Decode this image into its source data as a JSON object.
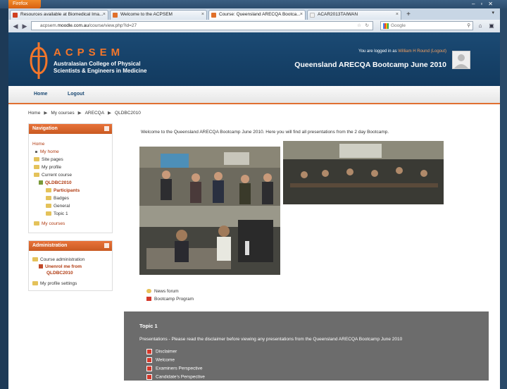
{
  "browser": {
    "app_button": "Firefox",
    "tabs": [
      {
        "label": "Resources available at Biomedical Ima...",
        "favicon_color": "#d04020"
      },
      {
        "label": "Welcome to the ACPSEM",
        "favicon_color": "#e0702a"
      },
      {
        "label": "Course: Queensland ARECQA Bootca...",
        "favicon_color": "#e0702a",
        "active": true
      },
      {
        "label": "ACAR2013TAIWAN",
        "favicon_color": "#f0f0f0"
      }
    ],
    "new_tab": "+",
    "url_prefix": "acpsem.",
    "url_domain": "moodle.com.au",
    "url_path": "/course/view.php?id=27",
    "search_placeholder": "Google"
  },
  "header": {
    "logo_text": "ACPSEM",
    "org_line1": "Australasian College of Physical",
    "org_line2": "Scientists & Engineers in Medicine",
    "login_prefix": "You are logged in as ",
    "login_user": "William H Round",
    "login_logout": "(Logout)",
    "site_title": "Queensland ARECQA Bootcamp June 2010"
  },
  "menu": {
    "home": "Home",
    "logout": "Logout"
  },
  "breadcrumb": [
    "Home",
    "My courses",
    "ARECQA",
    "QLDBC2010"
  ],
  "navigation_block": {
    "title": "Navigation",
    "items": [
      {
        "label": "Home",
        "type": "link"
      },
      {
        "label": "My home",
        "type": "link"
      },
      {
        "label": "Site pages",
        "type": "text"
      },
      {
        "label": "My profile",
        "type": "text"
      },
      {
        "label": "Current course",
        "type": "text"
      },
      {
        "label": "QLDBC2010",
        "type": "link"
      },
      {
        "label": "Participants",
        "type": "link"
      },
      {
        "label": "Badges",
        "type": "text"
      },
      {
        "label": "General",
        "type": "text"
      },
      {
        "label": "Topic 1",
        "type": "text"
      },
      {
        "label": "My courses",
        "type": "link"
      }
    ]
  },
  "admin_block": {
    "title": "Administration",
    "course_admin": "Course administration",
    "unenrol_line1": "Unenrol me from",
    "unenrol_line2": "QLDBC2010",
    "profile_settings": "My profile settings"
  },
  "main": {
    "welcome": "Welcome to the Queensland ARECQA Bootcamp June 2010. Here you will find all presentations from the 2 day Bootcamp.",
    "resources": [
      "News forum",
      "Bootcamp Program"
    ]
  },
  "topic": {
    "title": "Topic 1",
    "description": "Presentations - Please read the disclaimer before viewing any presentations from the Queensland ARECQA Bootcamp June 2010",
    "items": [
      "Disclaimer",
      "Welcome",
      "Examiners Perspective",
      "Candidate's Perspective"
    ]
  },
  "colors": {
    "header_blue": "#1b4a74",
    "accent_orange": "#e07030",
    "topic_grey": "#6c6c6c"
  }
}
